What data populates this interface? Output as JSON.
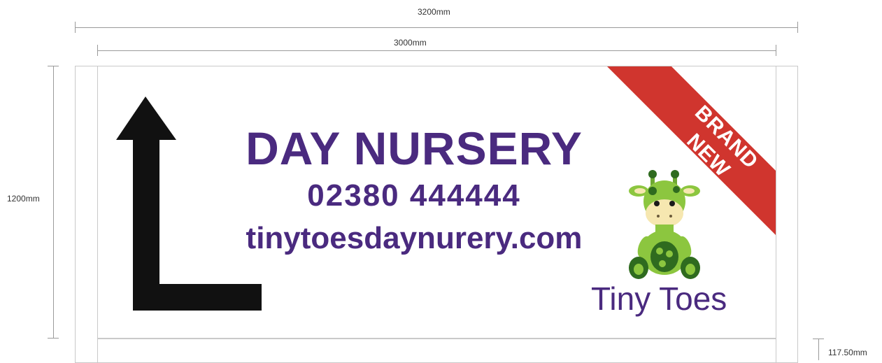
{
  "dimensions": {
    "outer_width": "3200mm",
    "panel_width": "3000mm",
    "height": "1200mm",
    "post_gap": "117.50mm"
  },
  "sign": {
    "title": "DAY NURSERY",
    "phone": "02380 444444",
    "website": "tinytoesdaynurery.com",
    "banner_line1": "BRAND",
    "banner_line2": "NEW",
    "brand_name": "Tiny Toes",
    "arrow_direction": "up-left",
    "mascot": "giraffe-icon"
  },
  "colors": {
    "text_purple": "#4a2a7f",
    "banner_red": "#d0352e",
    "arrow_black": "#111111",
    "giraffe_light": "#8cc63f",
    "giraffe_dark": "#2f6b1f",
    "giraffe_face": "#f6e7b0"
  }
}
